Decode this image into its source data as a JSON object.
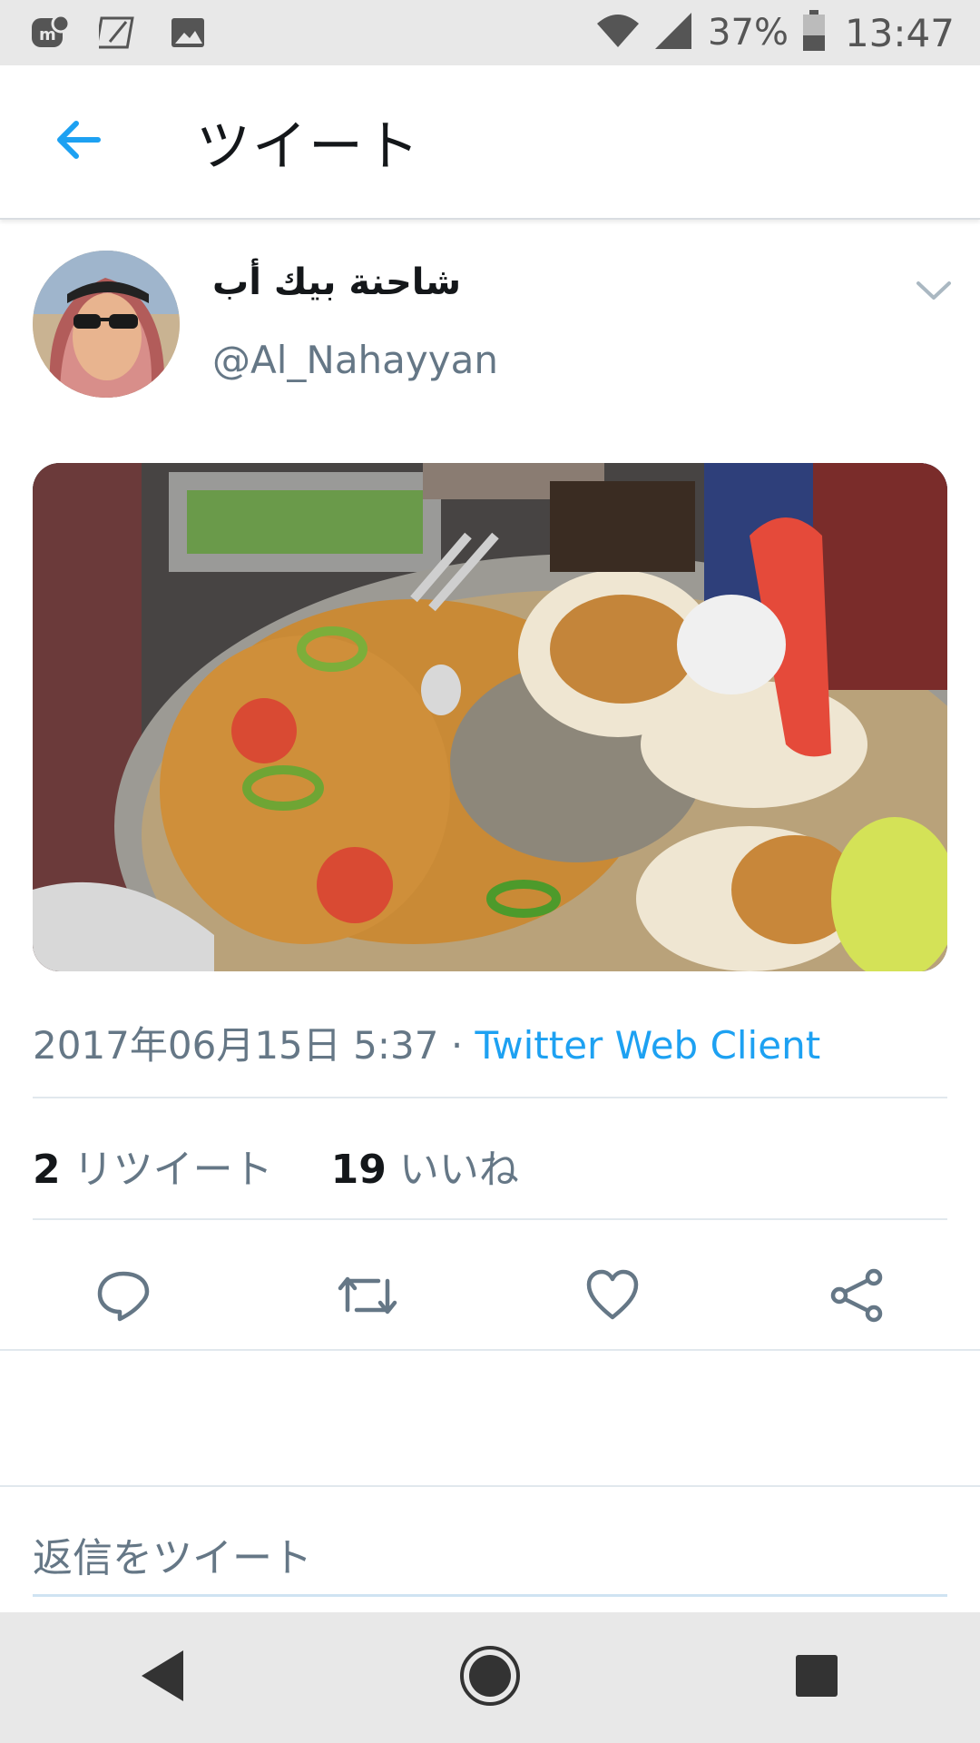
{
  "status_bar": {
    "battery": "37%",
    "time": "13:47",
    "left_icons": [
      "mastodon-icon",
      "edit-square-icon",
      "image-icon"
    ],
    "right_icons": [
      "wifi-icon",
      "signal-icon",
      "battery-icon"
    ]
  },
  "header": {
    "title": "ツイート",
    "back_icon": "arrow-left-icon"
  },
  "tweet": {
    "user_name": "شاحنة بيك أب",
    "handle": "@Al_Nahayyan",
    "timestamp": "2017年06月15日 5:37",
    "separator": "·",
    "client": "Twitter Web Client",
    "retweet_count": "2",
    "retweet_label": "リツイート",
    "like_count": "19",
    "like_label": "いいね"
  },
  "actions": [
    "reply-icon",
    "retweet-icon",
    "like-icon",
    "share-icon"
  ],
  "reply_box": {
    "placeholder": "返信をツイート"
  },
  "colors": {
    "accent": "#1da1f2",
    "text_secondary": "#657786",
    "text_primary": "#14171a",
    "divider": "#e1e8ed"
  }
}
